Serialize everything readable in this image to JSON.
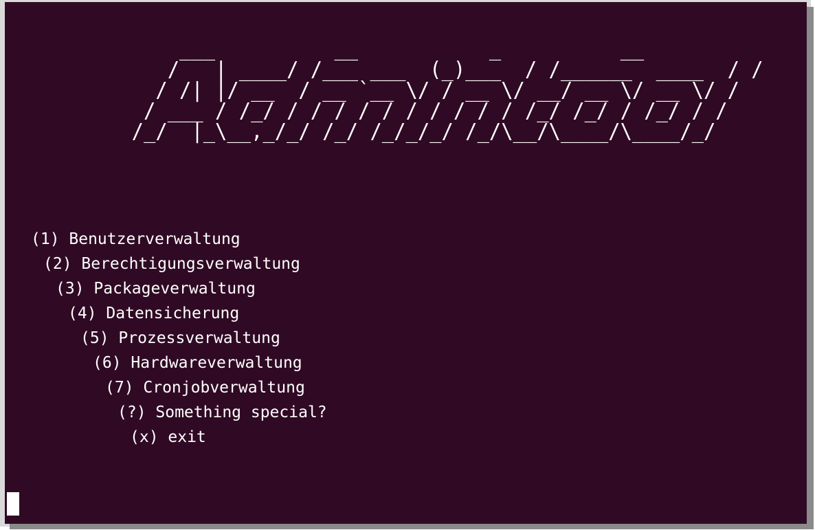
{
  "terminal": {
    "banner_lines": [
      "      ___          __           _          __                  __",
      "     /   | ____/ /___ ___  (_)___  / /______  ____  / /",
      "    / /| |/ __  / __ `__ \\/ / __ \\/ __/ __ \\/ __ \\/ /",
      "   / ___ / /_/ / / / / / / / / / / /_/ /_/ / /_/ / /",
      "  /_/  |_\\__,_/_/ /_/ /_/_/_/ /_/\\__/\\____/\\____/_/"
    ],
    "banner_text": "      ___          __           _          __                  __\n     /   | ____/ /___ ___  (_)___  / /______  ____  / /\n    / /| |/ __  / __ `__ \\/ / __ \\/ __/ __ \\/ __ \\/ /\n   / ___ / /_/ / / / / / / / / / / /_/ /_/ / /_/ / /\n  /_/  |_\\__,_/_/ /_/ /_/_/_/ /_/\\__/\\____/\\____/_/",
    "menu": [
      {
        "key": "1",
        "label": "(1) Benutzerverwaltung"
      },
      {
        "key": "2",
        "label": "(2) Berechtigungsverwaltung"
      },
      {
        "key": "3",
        "label": "(3) Packageverwaltung"
      },
      {
        "key": "4",
        "label": "(4) Datensicherung"
      },
      {
        "key": "5",
        "label": "(5) Prozessverwaltung"
      },
      {
        "key": "6",
        "label": "(6) Hardwareverwaltung"
      },
      {
        "key": "7",
        "label": "(7) Cronjobverwaltung"
      },
      {
        "key": "?",
        "label": "(?) Something special?"
      },
      {
        "key": "x",
        "label": "(x) exit"
      }
    ],
    "colors": {
      "background": "#300a24",
      "foreground": "#ffffff"
    }
  }
}
